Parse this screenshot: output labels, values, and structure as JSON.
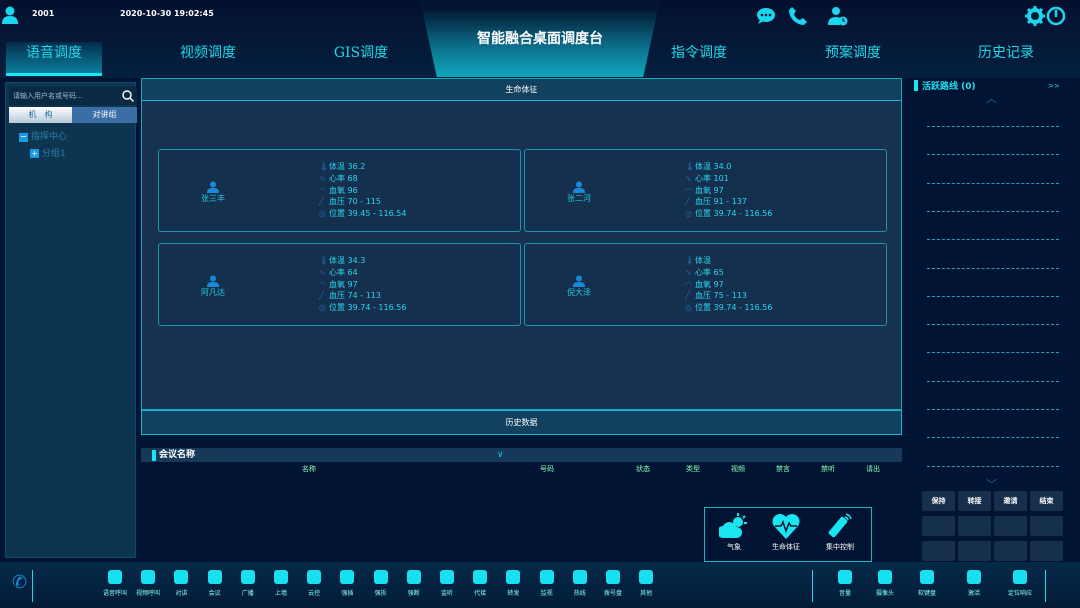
{
  "header": {
    "user_id": "2001",
    "datetime": "2020-10-30 19:02:45",
    "title": "智能融合桌面调度台",
    "tabs": [
      "语音调度",
      "视频调度",
      "GIS调度",
      "指令调度",
      "预案调度",
      "历史记录"
    ],
    "active_tab": 0
  },
  "left": {
    "search_placeholder": "请输入用户名或号码...",
    "seg": [
      "机　构",
      "对讲组"
    ],
    "tree": [
      "指挥中心",
      "分组1"
    ]
  },
  "vitals": {
    "title": "生命体征",
    "labels": [
      "体温",
      "心率",
      "血氧",
      "血压",
      "位置"
    ],
    "cards": [
      {
        "name": "张三丰",
        "temp": "36.2",
        "hr": "68",
        "spo2": "96",
        "bp": "70 - 115",
        "loc": "39.45 - 116.54"
      },
      {
        "name": "张二河",
        "temp": "34.0",
        "hr": "101",
        "spo2": "97",
        "bp": "91 - 137",
        "loc": "39.74 - 116.56"
      },
      {
        "name": "阿凡达",
        "temp": "34.3",
        "hr": "64",
        "spo2": "97",
        "bp": "74 - 113",
        "loc": "39.74 - 116.56"
      },
      {
        "name": "倪大泽",
        "temp": "",
        "hr": "65",
        "spo2": "97",
        "bp": "75 - 113",
        "loc": "39.74 - 116.56"
      }
    ]
  },
  "history": {
    "title": "历史数据",
    "meeting_label": "会议名称",
    "columns": [
      "名称",
      "号码",
      "状态",
      "类型",
      "视频",
      "禁言",
      "禁听",
      "请出"
    ]
  },
  "right": {
    "title": "活跃路线 (0)",
    "expand": ">>",
    "buttons": [
      "保持",
      "转接",
      "邀请",
      "结束"
    ]
  },
  "popup": [
    "气象",
    "生命体征",
    "集中控制"
  ],
  "toolbar": [
    "语音呼叫",
    "视频呼叫",
    "对讲",
    "会议",
    "广播",
    "上墙",
    "云控",
    "强插",
    "强拆",
    "强断",
    "监听",
    "代接",
    "转发",
    "监视",
    "热线",
    "拨号盘",
    "其他"
  ],
  "toolbar2": [
    "音量",
    "摄像头",
    "软键盘",
    "激活",
    "定位响应"
  ],
  "colors": {
    "accent": "#1fe0f0",
    "bg": "#021433",
    "panel": "#173150"
  }
}
